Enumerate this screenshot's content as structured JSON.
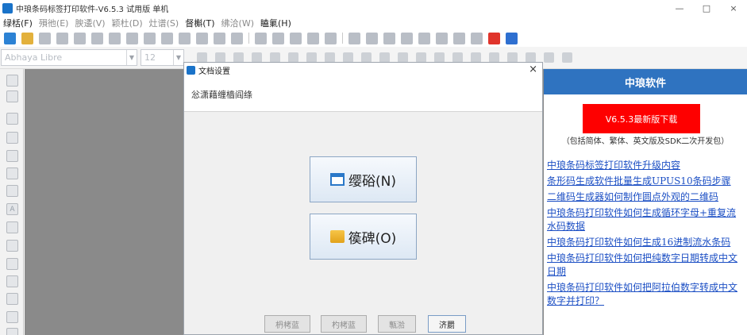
{
  "window": {
    "title": "中琅条码标签打印软件-V6.5.3 试用版 单机",
    "controls": {
      "minimize": "—",
      "maximize": "□",
      "close": "×"
    }
  },
  "menu": {
    "items": [
      {
        "label": "绿栝(F)",
        "enabled": true
      },
      {
        "label": "殞彵(E)",
        "enabled": false
      },
      {
        "label": "腴逶(V)",
        "enabled": false
      },
      {
        "label": "颖杜(D)",
        "enabled": false
      },
      {
        "label": "灶谱(S)",
        "enabled": false
      },
      {
        "label": "督槲(T)",
        "enabled": true
      },
      {
        "label": "绋洽(W)",
        "enabled": false
      },
      {
        "label": "瞌氭(H)",
        "enabled": true
      }
    ]
  },
  "toolbar2": {
    "font_value": "Abhaya Libre",
    "size_value": "12"
  },
  "dialog": {
    "title": "文档设置",
    "close": "×",
    "banner_text": "忩潇藉缠樯阎绦",
    "new_button": "缨硲(N)",
    "open_button": "篌碑(O)",
    "footer_buttons": [
      {
        "label": "枬栲蓝",
        "active": false
      },
      {
        "label": "杓栲蓝",
        "active": false
      },
      {
        "label": "甎湁",
        "active": false
      },
      {
        "label": "济罽",
        "active": true
      }
    ]
  },
  "right_panel": {
    "header": "中琅软件",
    "download_label": "V6.5.3最新版下载",
    "note": "（包括简体、繁体、英文版及SDK二次开发包）",
    "links": [
      "中琅条码标签打印软件升级内容",
      "条形码生成软件批量生成UPUS10条码步骤",
      "二维码生成器如何制作圆点外观的二维码",
      "中琅条码打印软件如何生成循环字母+重复流水码数据",
      "中琅条码打印软件如何生成16进制流水条码",
      "中琅条码打印软件如何把纯数字日期转成中文日期",
      "中琅条码打印软件如何把阿拉伯数字转成中文数字并打印？"
    ]
  },
  "icons": {
    "toolbar1": [
      "new-icon",
      "open-icon",
      "save-icon",
      "settings-icon",
      "print-icon",
      "print-preview-icon",
      "page-icon",
      "copy-page-icon",
      "grid-icon",
      "cut-icon",
      "copy-icon",
      "paste-icon",
      "undo-icon",
      "redo-icon",
      "zoom-in-icon",
      "zoom-out-icon",
      "zoom-fit-icon",
      "zoom-reset-icon",
      "fit-page-icon",
      "align-left-icon",
      "align-right-icon",
      "align-top-icon",
      "align-bottom-icon",
      "align-center-icon",
      "distribute-icon",
      "lock-icon",
      "group-icon",
      "pdf-icon",
      "database-icon"
    ],
    "left_tools": [
      "pointer-icon",
      "pan-icon",
      "line-icon",
      "rectangle-icon",
      "ellipse-icon",
      "barcode-icon",
      "qrcode-icon",
      "text-icon",
      "multiline-text-icon",
      "image-icon",
      "shape-icon",
      "table-icon",
      "polyline-icon",
      "arc-icon",
      "more-icon"
    ]
  },
  "colors": {
    "accent": "#2f73c0",
    "download_bg": "#fe0000",
    "link": "#1c4fc4",
    "workspace": "#8a8a8a"
  }
}
